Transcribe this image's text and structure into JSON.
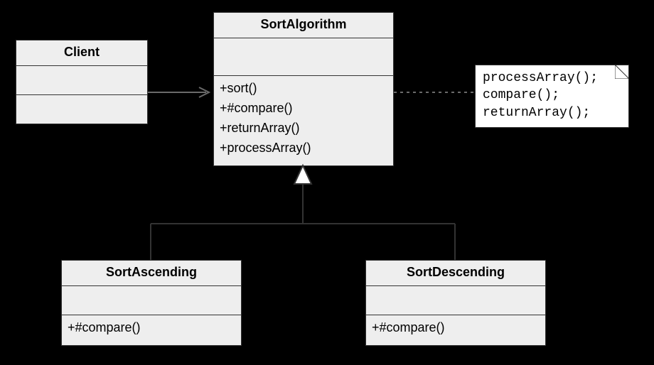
{
  "classes": {
    "client": {
      "name": "Client",
      "attrs": [],
      "ops": []
    },
    "sortAlgorithm": {
      "name": "SortAlgorithm",
      "attrs": [],
      "ops": [
        "+sort()",
        "+#compare()",
        "+returnArray()",
        "+processArray()"
      ]
    },
    "sortAscending": {
      "name": "SortAscending",
      "attrs": [],
      "ops": [
        "+#compare()"
      ]
    },
    "sortDescending": {
      "name": "SortDescending",
      "attrs": [],
      "ops": [
        "+#compare()"
      ]
    }
  },
  "note": {
    "lines": [
      "processArray();",
      "compare();",
      "returnArray();"
    ]
  }
}
